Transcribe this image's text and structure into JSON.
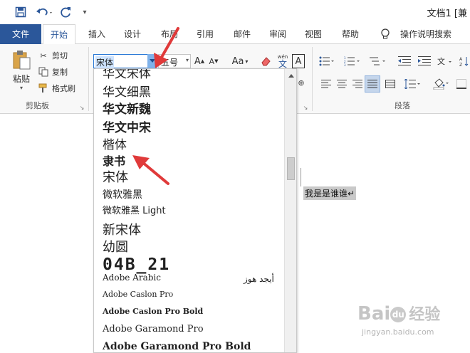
{
  "window": {
    "title": "文档1 [兼"
  },
  "qat": {
    "customize_glyph": "▾"
  },
  "tabs": [
    {
      "label": "文件"
    },
    {
      "label": "开始"
    },
    {
      "label": "插入"
    },
    {
      "label": "设计"
    },
    {
      "label": "布局"
    },
    {
      "label": "引用"
    },
    {
      "label": "邮件"
    },
    {
      "label": "审阅"
    },
    {
      "label": "视图"
    },
    {
      "label": "帮助"
    },
    {
      "label": "操作说明搜索"
    }
  ],
  "clipboard": {
    "paste": "粘贴",
    "cut": "剪切",
    "copy": "复制",
    "format_painter": "格式刷",
    "group": "剪贴板"
  },
  "font": {
    "current_font": "宋体",
    "current_size": "五号",
    "grow": "A",
    "shrink": "A",
    "case": "Aa",
    "phonetic_top": "wén",
    "phonetic_bottom": "文",
    "border_char": "A"
  },
  "paragraph": {
    "group": "段落"
  },
  "document": {
    "text": "我是是谁谁↵"
  },
  "font_list": [
    {
      "name": "华文宋体",
      "font": "serif",
      "size": 17
    },
    {
      "name": "华文细黑",
      "font": "sans",
      "size": 17
    },
    {
      "name": "华文新魏",
      "font": "serif",
      "size": 17,
      "bold": true
    },
    {
      "name": "华文中宋",
      "font": "serif",
      "size": 17,
      "bold": true
    },
    {
      "name": "楷体",
      "font": "serif",
      "size": 17
    },
    {
      "name": "隶书",
      "font": "serif",
      "size": 16,
      "bold": true
    },
    {
      "name": "宋体",
      "font": "serif",
      "size": 18
    },
    {
      "name": "微软雅黑",
      "font": "sans",
      "size": 14
    },
    {
      "name": "微软雅黑 Light",
      "font": "sans",
      "size": 13
    },
    {
      "name": "新宋体",
      "font": "serif",
      "size": 18
    },
    {
      "name": "幼圆",
      "font": "sans",
      "size": 18
    },
    {
      "name": "04B_21",
      "font": "mono",
      "size": 23,
      "bold": true
    },
    {
      "name": "Adobe Arabic",
      "font": "serif",
      "size": 12,
      "sample": "أيجد هوز"
    },
    {
      "name": "Adobe Caslon Pro",
      "font": "serif",
      "size": 11
    },
    {
      "name": "Adobe Caslon Pro Bold",
      "font": "serif",
      "size": 11,
      "bold": true
    },
    {
      "name": "Adobe Garamond Pro",
      "font": "serif",
      "size": 13
    },
    {
      "name": "Adobe Garamond Pro Bold",
      "font": "serif",
      "size": 14,
      "bold": true
    }
  ],
  "colors": {
    "brand_blue": "#2b579a",
    "arrow_red": "#e03a3a"
  },
  "watermark": {
    "brand": "Bai",
    "paw": "du",
    "cn": "经验",
    "url": "jingyan.baidu.com"
  }
}
